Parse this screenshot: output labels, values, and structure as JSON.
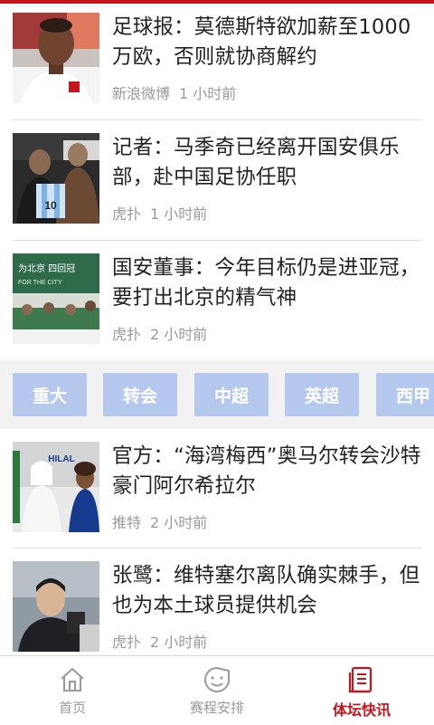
{
  "news": [
    {
      "title": "足球报：莫德斯特欲加薪至1000万欧，否则就协商解约",
      "source": "新浪微博",
      "time": "1 小时前"
    },
    {
      "title": "记者：马季奇已经离开国安俱乐部，赴中国足协任职",
      "source": "虎扑",
      "time": "1 小时前"
    },
    {
      "title": "国安董事：今年目标仍是进亚冠，要打出北京的精气神",
      "source": "虎扑",
      "time": "2 小时前"
    },
    {
      "title": "官方：“海湾梅西”奥马尔转会沙特豪门阿尔希拉尔",
      "source": "推特",
      "time": "2 小时前"
    },
    {
      "title": "张鹭：维特塞尔离队确实棘手，但也为本土球员提供机会",
      "source": "虎扑",
      "time": "2 小时前"
    }
  ],
  "image_texts": {
    "jersey_number": "10",
    "banner_text": "为北京 四回冠",
    "banner_sub": "FOR THE CITY",
    "wall_text": "HILAL"
  },
  "tags": [
    "重大",
    "转会",
    "中超",
    "英超",
    "西甲"
  ],
  "nav": [
    {
      "label": "首页",
      "icon": "home-icon",
      "active": false
    },
    {
      "label": "赛程安排",
      "icon": "smiley-icon",
      "active": false
    },
    {
      "label": "体坛快讯",
      "icon": "news-icon",
      "active": true
    }
  ],
  "colors": {
    "accent": "#c4161c",
    "tag_bg": "#b5c9ee",
    "muted": "#9a9a9a"
  }
}
